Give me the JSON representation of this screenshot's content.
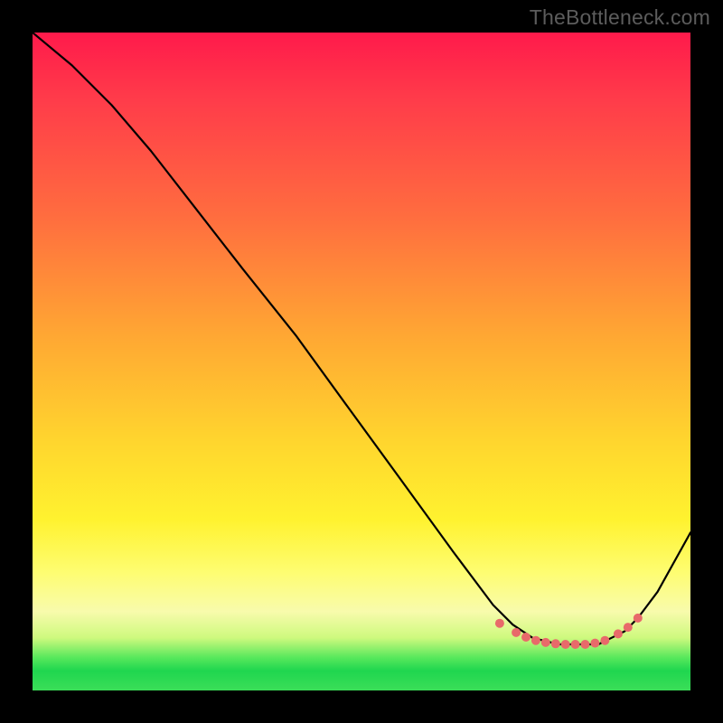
{
  "watermark": "TheBottleneck.com",
  "chart_data": {
    "type": "line",
    "title": "",
    "xlabel": "",
    "ylabel": "",
    "xlim": [
      0,
      100
    ],
    "ylim": [
      0,
      100
    ],
    "series": [
      {
        "name": "curve",
        "x": [
          0,
          6,
          12,
          18,
          25,
          32,
          40,
          48,
          56,
          64,
          70,
          73,
          76,
          80,
          84,
          86,
          88,
          90,
          92,
          95,
          100
        ],
        "y": [
          100,
          95,
          89,
          82,
          73,
          64,
          54,
          43,
          32,
          21,
          13,
          10,
          8,
          7,
          7,
          7,
          8,
          9,
          11,
          15,
          24
        ]
      }
    ],
    "markers": {
      "name": "optimum-zone",
      "x": [
        71,
        73.5,
        75,
        76.5,
        78,
        79.5,
        81,
        82.5,
        84,
        85.5,
        87,
        89,
        90.5,
        92
      ],
      "y": [
        10.2,
        8.8,
        8.1,
        7.6,
        7.3,
        7.1,
        7.0,
        7.0,
        7.0,
        7.2,
        7.6,
        8.6,
        9.6,
        11.0
      ],
      "color": "#e86a6a",
      "radius": 5
    },
    "gradient_stops": [
      {
        "pos": 0.0,
        "color": "#ff1a4b"
      },
      {
        "pos": 0.28,
        "color": "#ff6d3f"
      },
      {
        "pos": 0.62,
        "color": "#ffd52e"
      },
      {
        "pos": 0.88,
        "color": "#f8fbac"
      },
      {
        "pos": 0.96,
        "color": "#1fd64f"
      },
      {
        "pos": 1.0,
        "color": "#3bde58"
      }
    ]
  }
}
